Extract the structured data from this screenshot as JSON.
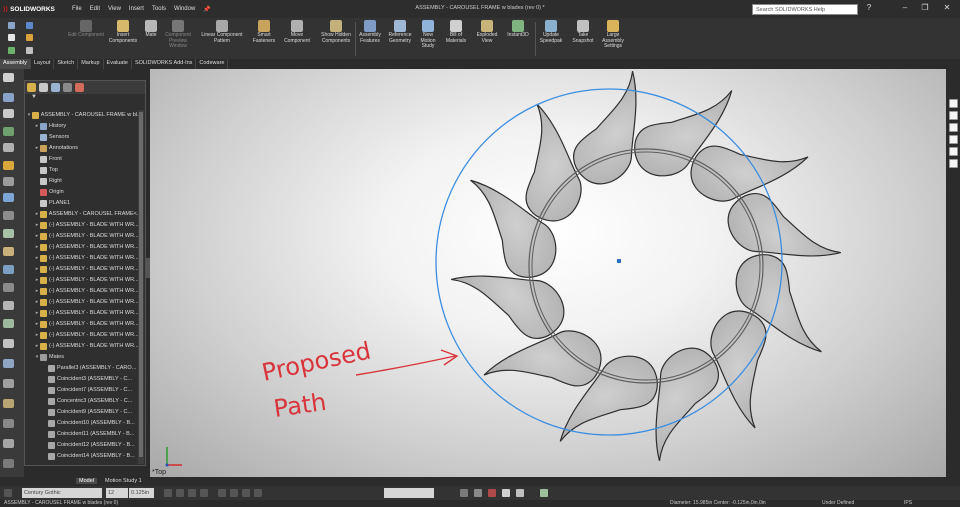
{
  "app": {
    "name": "SOLIDWORKS",
    "document_title": "ASSEMBLY - CAROUSEL FRAME w blades (rev 0) *"
  },
  "menu": [
    "File",
    "Edit",
    "View",
    "Insert",
    "Tools",
    "Window"
  ],
  "search": {
    "placeholder": "Search SOLIDWORKS Help"
  },
  "window_controls": {
    "help": "?",
    "minimize": "–",
    "restore": "❐",
    "close": "✕"
  },
  "toolbar": {
    "edit_component": "Edit Component",
    "insert_components": "Insert Components",
    "mate": "Mate",
    "component_preview": "Component Preview Window",
    "linear_pattern": "Linear Component Pattern",
    "smart_fasteners": "Smart Fasteners",
    "move_component": "Move Component",
    "show_hidden": "Show Hidden Components",
    "assembly_features": "Assembly Features",
    "reference_geometry": "Reference Geometry",
    "new_motion_study": "New Motion Study",
    "bill_of_materials": "Bill of Materials",
    "exploded_view": "Exploded View",
    "instant3d": "Instant3D",
    "update_speedpak": "Update Speedpak",
    "take_snapshot": "Take Snapshot",
    "large_assembly": "Large Assembly Settings"
  },
  "command_tabs": [
    "Assembly",
    "Layout",
    "Sketch",
    "Markup",
    "Evaluate",
    "SOLIDWORKS Add-Ins",
    "Codeware"
  ],
  "feature_tree": {
    "filter_icon": "funnel-icon",
    "nodes": [
      {
        "label": "ASSEMBLY - CAROUSEL FRAME w bl...",
        "type": "assembly"
      },
      {
        "label": "History",
        "type": "folder"
      },
      {
        "label": "Sensors",
        "type": "sensor"
      },
      {
        "label": "Annotations",
        "type": "annotation"
      },
      {
        "label": "Front",
        "type": "plane"
      },
      {
        "label": "Top",
        "type": "plane"
      },
      {
        "label": "Right",
        "type": "plane"
      },
      {
        "label": "Origin",
        "type": "origin"
      },
      {
        "label": "PLANE1",
        "type": "plane"
      },
      {
        "label": "ASSEMBLY - CAROUSEL FRAME<...",
        "type": "component"
      },
      {
        "label": "(-) ASSEMBLY - BLADE WITH WR...",
        "type": "component"
      },
      {
        "label": "(-) ASSEMBLY - BLADE WITH WR...",
        "type": "component"
      },
      {
        "label": "(-) ASSEMBLY - BLADE WITH WR...",
        "type": "component"
      },
      {
        "label": "(-) ASSEMBLY - BLADE WITH WR...",
        "type": "component"
      },
      {
        "label": "(-) ASSEMBLY - BLADE WITH WR...",
        "type": "component"
      },
      {
        "label": "(-) ASSEMBLY - BLADE WITH WR...",
        "type": "component"
      },
      {
        "label": "(-) ASSEMBLY - BLADE WITH WR...",
        "type": "component"
      },
      {
        "label": "(-) ASSEMBLY - BLADE WITH WR...",
        "type": "component"
      },
      {
        "label": "(-) ASSEMBLY - BLADE WITH WR...",
        "type": "component"
      },
      {
        "label": "(-) ASSEMBLY - BLADE WITH WR...",
        "type": "component"
      },
      {
        "label": "(-) ASSEMBLY - BLADE WITH WR...",
        "type": "component"
      },
      {
        "label": "(-) ASSEMBLY - BLADE WITH WR...",
        "type": "component"
      },
      {
        "label": "Mates",
        "type": "mates"
      },
      {
        "label": "Parallel3 (ASSEMBLY - CARO...",
        "type": "mate"
      },
      {
        "label": "Coincident3 (ASSEMBLY - C...",
        "type": "mate"
      },
      {
        "label": "Coincident7 (ASSEMBLY - C...",
        "type": "mate"
      },
      {
        "label": "Concentric3 (ASSEMBLY - C...",
        "type": "mate"
      },
      {
        "label": "Coincident9 (ASSEMBLY - C...",
        "type": "mate"
      },
      {
        "label": "Coincident10 (ASSEMBLY - B...",
        "type": "mate"
      },
      {
        "label": "Coincident11 (ASSEMBLY - B...",
        "type": "mate"
      },
      {
        "label": "Coincident12 (ASSEMBLY - B...",
        "type": "mate"
      },
      {
        "label": "Coincident14 (ASSEMBLY - B...",
        "type": "mate"
      }
    ]
  },
  "viewport": {
    "annotation_line1": "Proposed",
    "annotation_line2": "Path",
    "view_label": "*Top",
    "annotation_color": "#d9343b",
    "path_circle_color": "#3b8ee0"
  },
  "bottom_tabs": [
    "Model",
    "Motion Study 1"
  ],
  "format_bar": {
    "font": "Century Gothic",
    "size": "12",
    "height": "0.125in"
  },
  "status": {
    "left": "ASSEMBLY - CAROUSEL FRAME w blades (rev 0)",
    "measure": "Diameter: 15.985in  Center: -0.125in,0in,0in",
    "state": "Under Defined",
    "units": "IPS"
  }
}
